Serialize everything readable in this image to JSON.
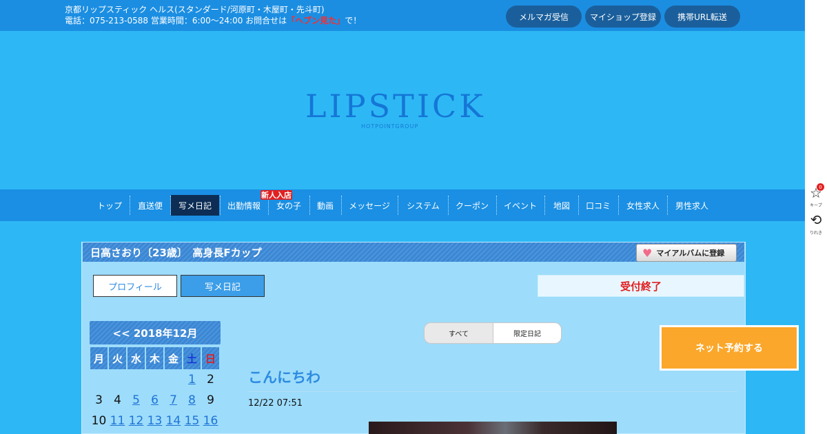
{
  "topbar": {
    "line1": "京都リップスティック ヘルス(スタンダード/河原町・木屋町・先斗町)",
    "line2_prefix": "電話：075-213-0588 営業時間：6:00～24:00 お問合せは",
    "line2_highlight": "「ヘブン見た」",
    "line2_suffix": "で！",
    "buttons": [
      "メルマガ受信",
      "マイショップ登録",
      "携帯URL転送"
    ]
  },
  "logo": {
    "text": "LIPSTICK",
    "sub": "HOTPOINTGROUP"
  },
  "nav": {
    "items": [
      "トップ",
      "直送便",
      "写メ日記",
      "出勤情報",
      "女の子",
      "動画",
      "メッセージ",
      "システム",
      "クーポン",
      "イベント",
      "地図",
      "口コミ",
      "女性求人",
      "男性求人"
    ],
    "active_index": 2,
    "new_badge": "新人入店"
  },
  "profile": {
    "title": "日高さおり〔23歳〕　高身長Fカップ",
    "album_button": "マイアルバムに登録",
    "tabs": [
      "プロフィール",
      "写メ日記"
    ],
    "status": "受付終了"
  },
  "calendar": {
    "header": "<< 2018年12月",
    "weekdays": [
      "月",
      "火",
      "水",
      "木",
      "金",
      "土",
      "日"
    ],
    "rows": [
      [
        "",
        "",
        "",
        "",
        "",
        "1",
        "2"
      ],
      [
        "3",
        "4",
        "5",
        "6",
        "7",
        "8",
        "9"
      ],
      [
        "10",
        "11",
        "12",
        "13",
        "14",
        "15",
        "16"
      ]
    ],
    "linked": [
      "1",
      "5",
      "6",
      "7",
      "8",
      "11",
      "12",
      "13",
      "14",
      "15",
      "16"
    ]
  },
  "diary": {
    "filters": [
      "すべて",
      "限定日記"
    ],
    "entry_title": "こんにちわ",
    "entry_date": "12/22 07:51"
  },
  "reserve_button": "ネット予約する",
  "rail": {
    "keep_label": "キープ",
    "keep_count": "0",
    "history_label": "りれき"
  },
  "colors": {
    "background": "#2db8f5",
    "topbar": "#1b8ee2",
    "nav_active": "#0d2d55",
    "accent_blue": "#2d8be0",
    "alert_red": "#e11d1d",
    "reserve_orange": "#fba72b"
  }
}
